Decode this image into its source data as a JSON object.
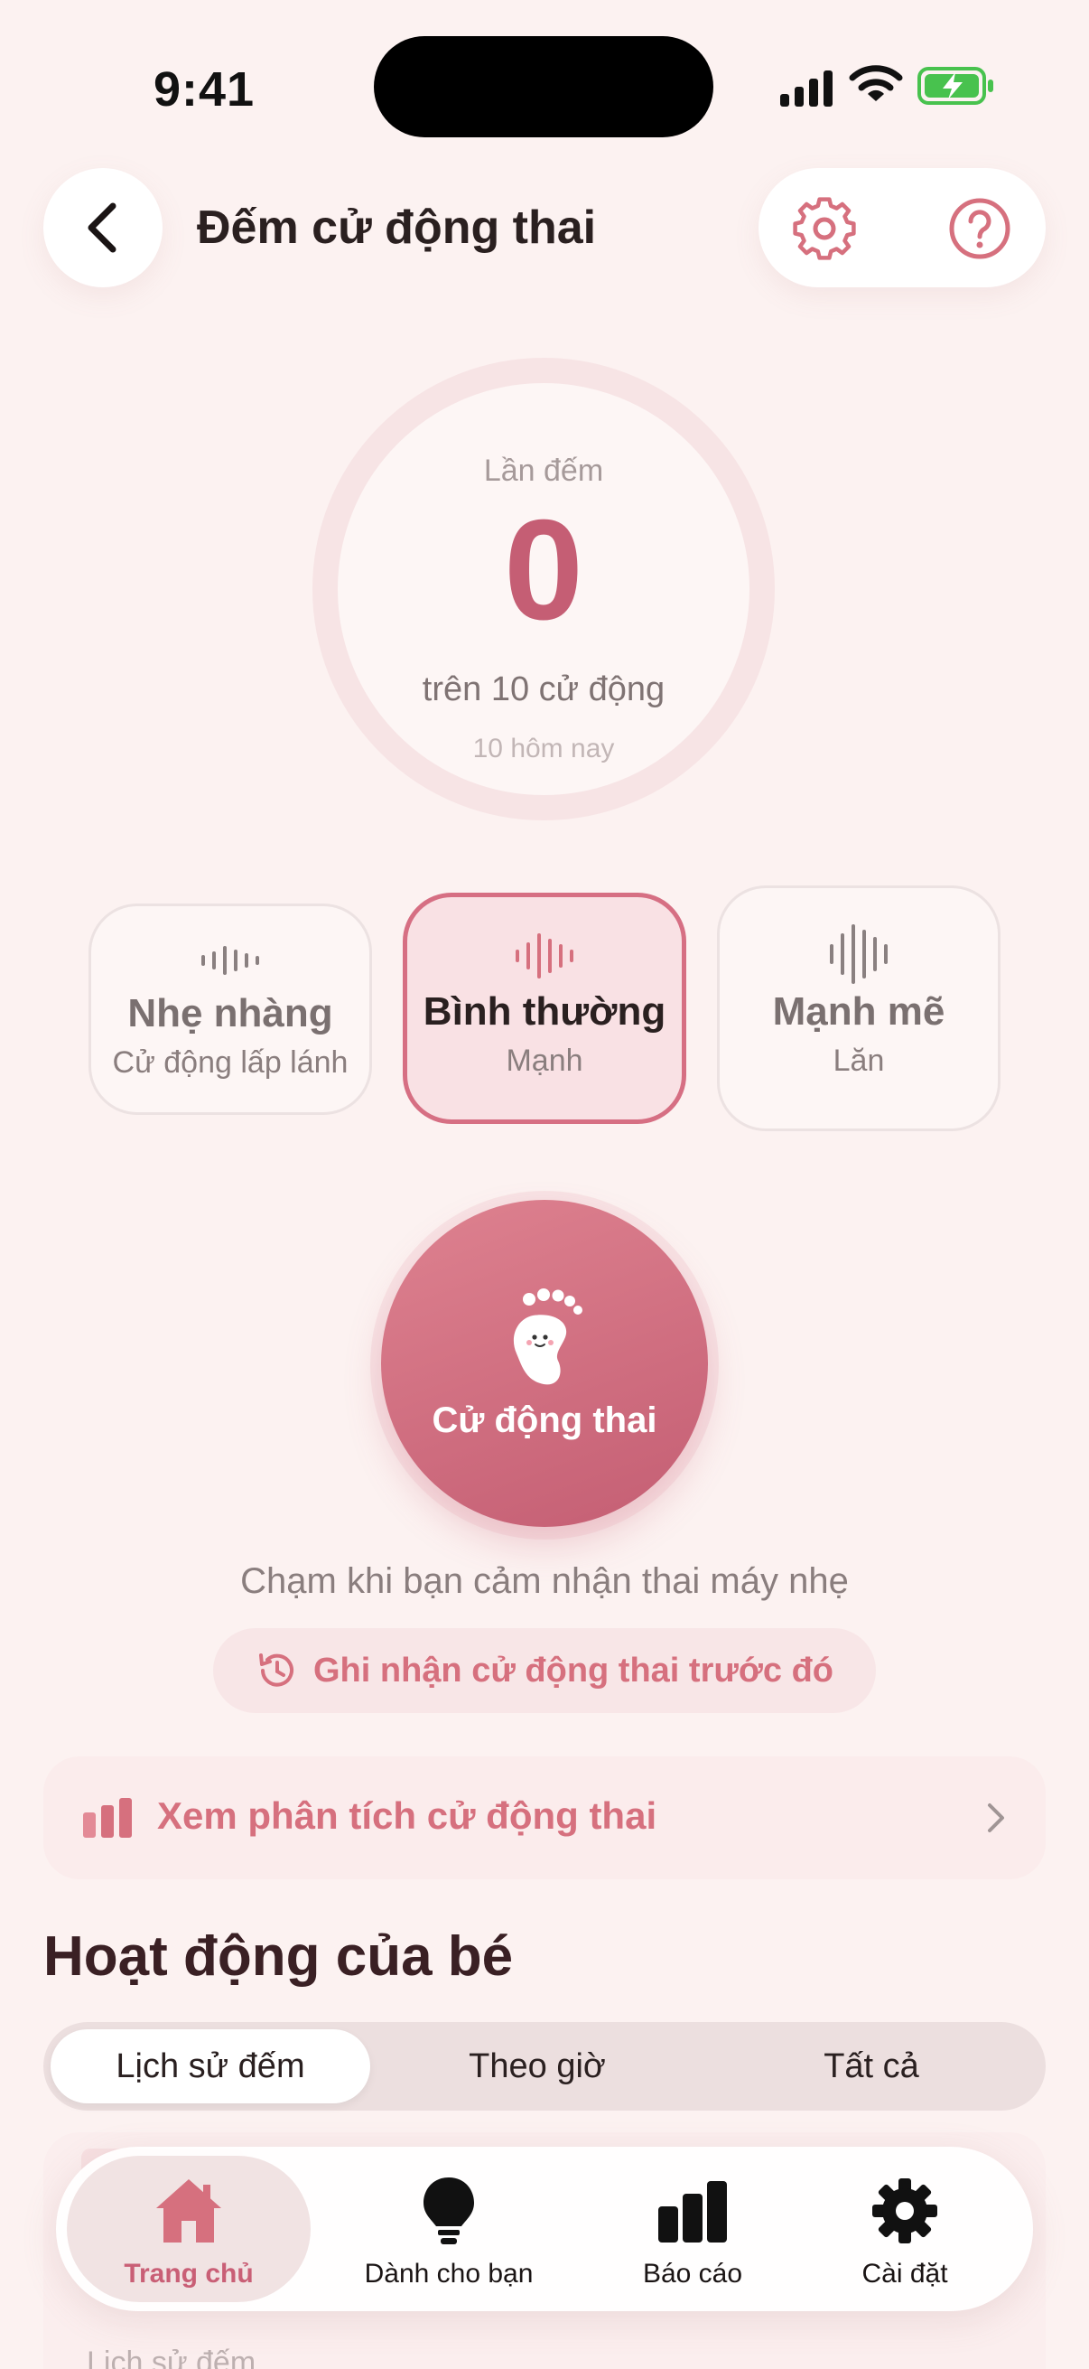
{
  "status": {
    "time": "9:41"
  },
  "header": {
    "title": "Đếm cử động thai"
  },
  "counter": {
    "label": "Lần đếm",
    "count": "0",
    "target": "trên 10 cử động",
    "today": "10 hôm nay"
  },
  "strength_options": [
    {
      "title": "Nhẹ nhàng",
      "subtitle": "Cử động lấp lánh",
      "selected": false
    },
    {
      "title": "Bình thường",
      "subtitle": "Mạnh",
      "selected": true
    },
    {
      "title": "Mạnh mẽ",
      "subtitle": "Lăn",
      "selected": false
    }
  ],
  "kick_button": {
    "label": "Cử động thai"
  },
  "tap_hint": "Chạm khi bạn cảm nhận thai máy nhẹ",
  "record_previous": {
    "label": "Ghi nhận cử động thai trước đó"
  },
  "analysis": {
    "label": "Xem phân tích cử động thai"
  },
  "activity": {
    "title": "Hoạt động của bé",
    "tabs": [
      "Lịch sử đếm",
      "Theo giờ",
      "Tất cả"
    ],
    "selected_tab": 0,
    "peek_text": "Lịch sử đếm"
  },
  "tabbar": {
    "items": [
      {
        "label": "Trang chủ",
        "icon": "home-icon",
        "active": true
      },
      {
        "label": "Dành cho bạn",
        "icon": "lightbulb-icon",
        "active": false
      },
      {
        "label": "Báo cáo",
        "icon": "bar-chart-icon",
        "active": false
      },
      {
        "label": "Cài đặt",
        "icon": "gear-icon",
        "active": false
      }
    ]
  },
  "colors": {
    "background": "#fcf2f1",
    "accent": "#c95f76",
    "accent_light": "#f9e1e4",
    "text_dark": "#2a2020"
  }
}
